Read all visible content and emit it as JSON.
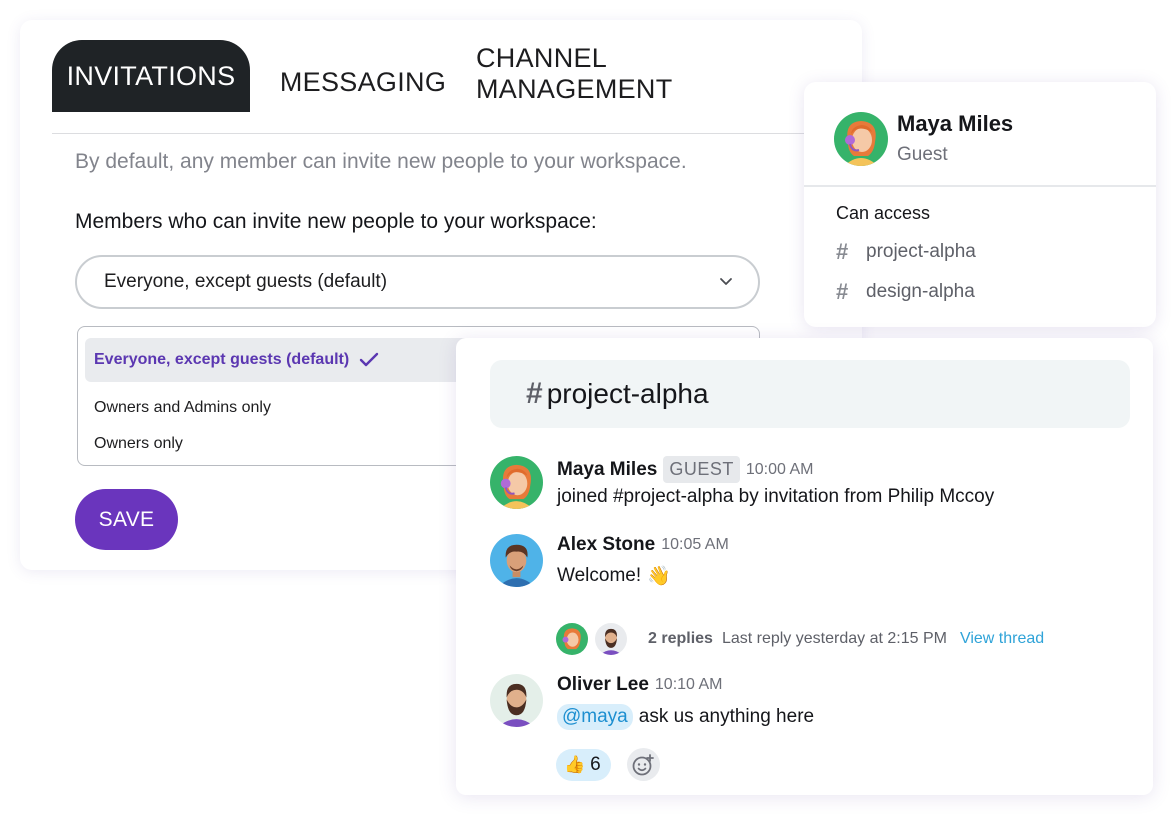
{
  "settings": {
    "tabs": [
      {
        "label": "INVITATIONS",
        "active": true
      },
      {
        "label": "MESSAGING",
        "active": false
      },
      {
        "label": "CHANNEL MANAGEMENT",
        "active": false
      }
    ],
    "default_note": "By default, any member can invite new people to your workspace.",
    "members_label": "Members who can invite new people to your workspace:",
    "select_value": "Everyone, except guests (default)",
    "options": [
      {
        "label": "Everyone, except guests (default)",
        "selected": true
      },
      {
        "label": "Owners and Admins only",
        "selected": false
      },
      {
        "label": "Owners only",
        "selected": false
      }
    ],
    "save_label": "SAVE"
  },
  "profile": {
    "name": "Maya Miles",
    "role": "Guest",
    "access_label": "Can access",
    "channels": [
      "project-alpha",
      "design-alpha"
    ]
  },
  "channel": {
    "hash": "#",
    "title": "project-alpha",
    "messages": [
      {
        "author": "Maya Miles",
        "badge": "GUEST",
        "time": "10:00 AM",
        "text": "joined #project-alpha by invitation from Philip Mccoy",
        "avatar": "female-avatar-icon"
      },
      {
        "author": "Alex Stone",
        "time": "10:05 AM",
        "text": "Welcome!",
        "emoji": "👋",
        "avatar": "male-avatar-icon"
      },
      {
        "author": "Oliver Lee",
        "time": "10:10 AM",
        "mention": "@maya",
        "text": "ask us anything here",
        "avatar": "bearded-avatar-icon"
      }
    ],
    "thread": {
      "replies": "2 replies",
      "last_reply": "Last reply yesterday at 2:15 PM",
      "view_label": "View thread"
    },
    "reaction": {
      "emoji": "👍",
      "count": "6"
    }
  },
  "colors": {
    "accent": "#6a35bd",
    "tab_active": "#1f2326",
    "link": "#2fa3d8",
    "mention_bg": "#d8eefb"
  }
}
